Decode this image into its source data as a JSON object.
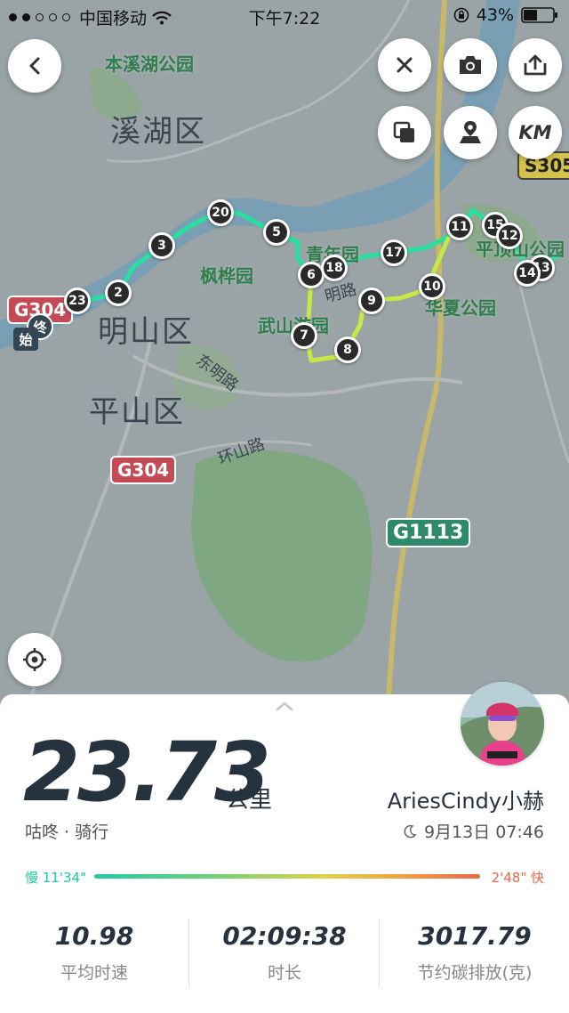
{
  "status_bar": {
    "carrier": "中国移动",
    "time": "下午7:22",
    "battery": "43%"
  },
  "map": {
    "places": {
      "park1": "本溪湖公园",
      "district1": "溪湖区",
      "park2": "枫桦园",
      "park3": "青年园",
      "park4": "武山游园",
      "park5": "华夏公园",
      "park6": "平顶山公园",
      "district2": "明山区",
      "district3": "平山区",
      "road1": "东明路",
      "road2": "环山路",
      "road3": "明路"
    },
    "shields": {
      "g304_top": "G304",
      "g304_mid": "G304",
      "g1113": "G1113",
      "s305": "S305"
    },
    "waypoints": [
      "20",
      "3",
      "2",
      "23",
      "5",
      "6",
      "18",
      "7",
      "8",
      "9",
      "17",
      "10",
      "11",
      "15",
      "12",
      "13",
      "14"
    ],
    "start_label": "始",
    "end_label": "终"
  },
  "activity": {
    "distance": "23.73",
    "distance_unit": "公里",
    "sport": "咕咚 · 骑行",
    "username": "AriesCindy小赫",
    "date": "9月13日 07:46",
    "pace_slow_label": "慢 11'34\"",
    "pace_fast_label": "2'48\" 快"
  },
  "stats": [
    {
      "value": "10.98",
      "label": "平均时速"
    },
    {
      "value": "02:09:38",
      "label": "时长"
    },
    {
      "value": "3017.79",
      "label": "节约碳排放(克)"
    }
  ],
  "colors": {
    "route_fast": "#27e0a0",
    "route_slow": "#c8e848",
    "text_dark": "#26323e",
    "park_green": "#2f7d4b"
  }
}
